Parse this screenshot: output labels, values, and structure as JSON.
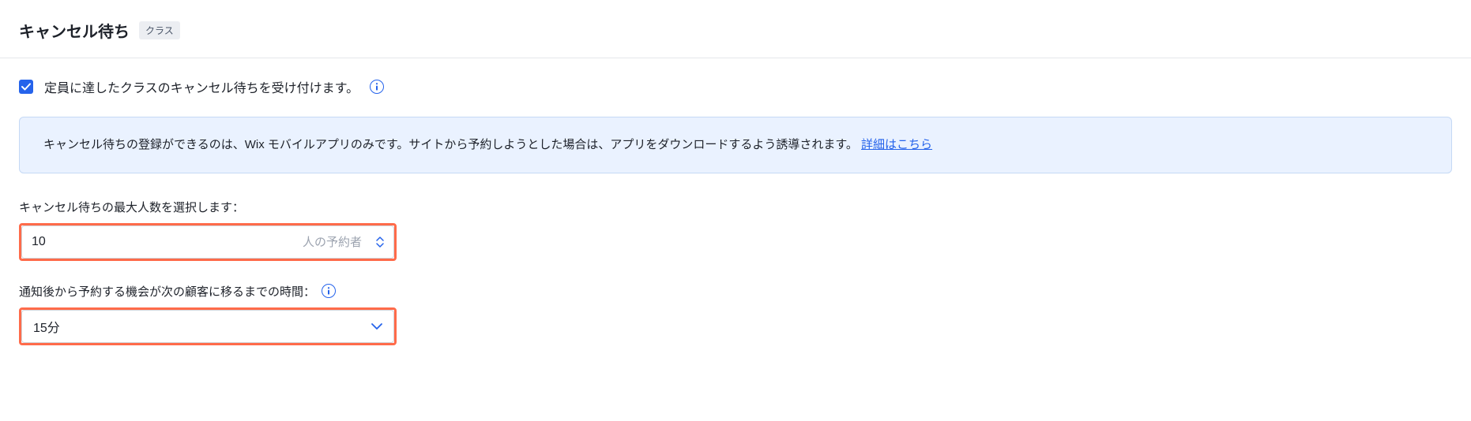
{
  "header": {
    "title": "キャンセル待ち",
    "badge": "クラス"
  },
  "enable_waitlist": {
    "checked": true,
    "label": "定員に達したクラスのキャンセル待ちを受け付けます。"
  },
  "info_banner": {
    "text": "キャンセル待ちの登録ができるのは、Wix モバイルアプリのみです。サイトから予約しようとした場合は、アプリをダウンロードするよう誘導されます。",
    "link_text": "詳細はこちら"
  },
  "max_people": {
    "label": "キャンセル待ちの最大人数を選択します：",
    "value": "10",
    "suffix": "人の予約者"
  },
  "time_window": {
    "label": "通知後から予約する機会が次の顧客に移るまでの時間：",
    "value": "15分"
  }
}
